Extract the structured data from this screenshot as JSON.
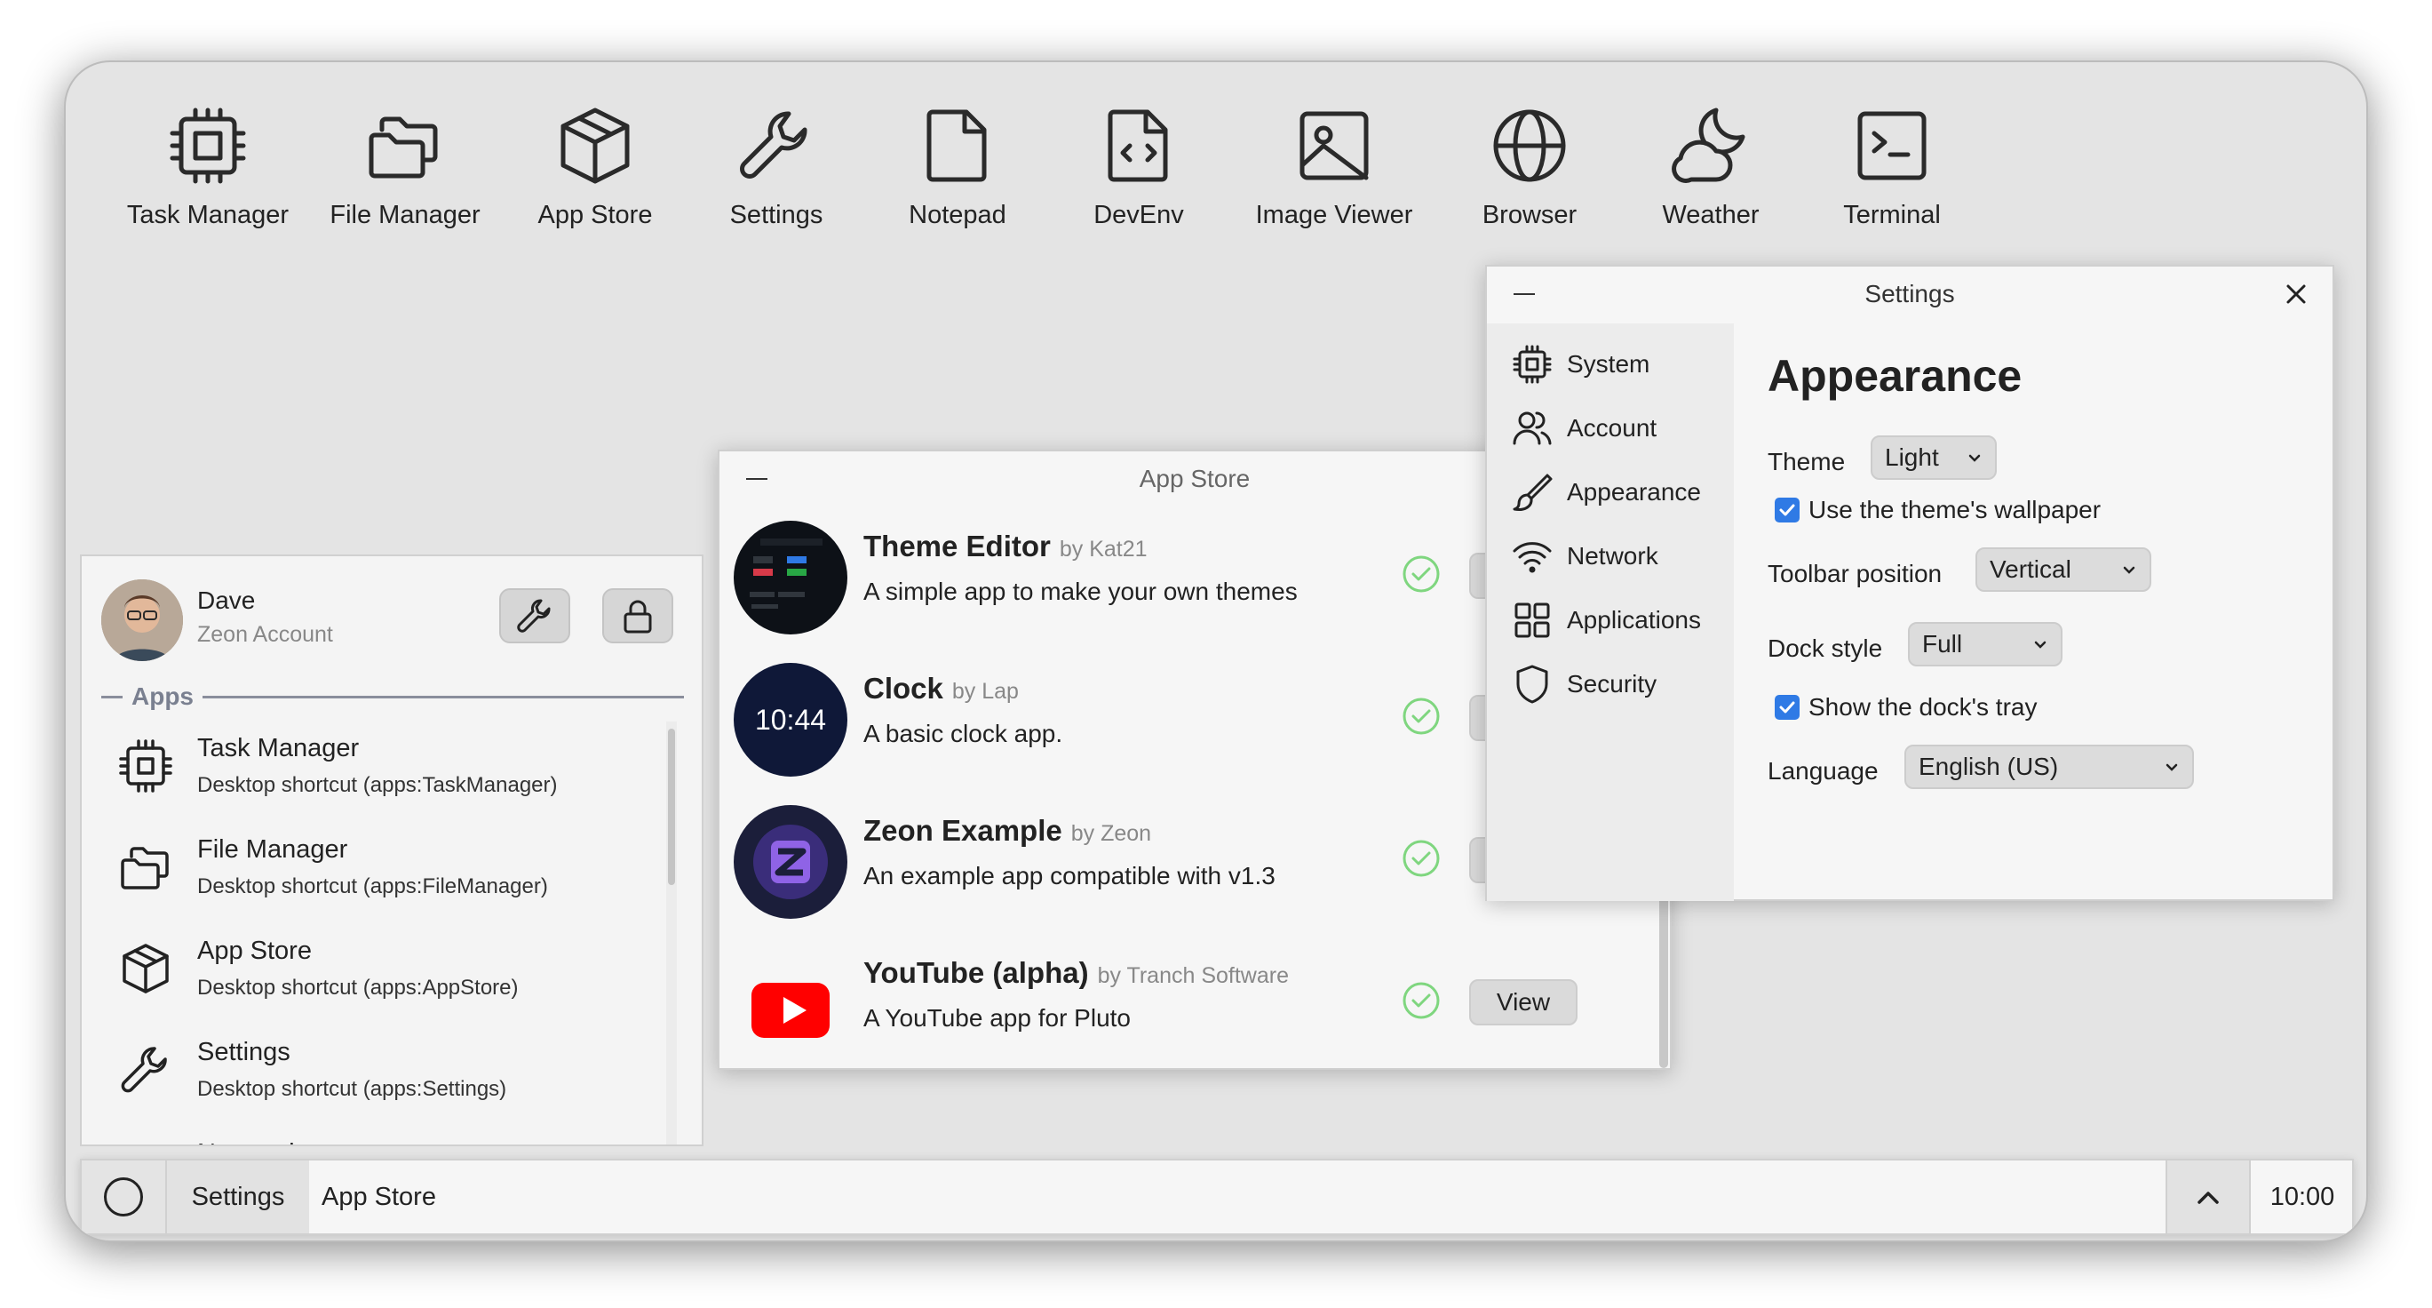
{
  "desktop": {
    "icons": [
      {
        "label": "Task Manager",
        "icon": "cpu-icon"
      },
      {
        "label": "File Manager",
        "icon": "folder-icon"
      },
      {
        "label": "App Store",
        "icon": "package-icon"
      },
      {
        "label": "Settings",
        "icon": "wrench-icon"
      },
      {
        "label": "Notepad",
        "icon": "file-icon"
      },
      {
        "label": "DevEnv",
        "icon": "code-file-icon"
      },
      {
        "label": "Image Viewer",
        "icon": "image-icon"
      },
      {
        "label": "Browser",
        "icon": "globe-icon"
      },
      {
        "label": "Weather",
        "icon": "cloud-moon-icon"
      },
      {
        "label": "Terminal",
        "icon": "terminal-icon"
      }
    ]
  },
  "launcher": {
    "user_name": "Dave",
    "user_account": "Zeon Account",
    "apps_header": "Apps",
    "apps": [
      {
        "name": "Task Manager",
        "desc": "Desktop shortcut (apps:TaskManager)",
        "icon": "cpu-icon"
      },
      {
        "name": "File Manager",
        "desc": "Desktop shortcut (apps:FileManager)",
        "icon": "folder-icon"
      },
      {
        "name": "App Store",
        "desc": "Desktop shortcut (apps:AppStore)",
        "icon": "package-icon"
      },
      {
        "name": "Settings",
        "desc": "Desktop shortcut (apps:Settings)",
        "icon": "wrench-icon"
      },
      {
        "name": "Notepad",
        "desc": "",
        "icon": "file-icon"
      }
    ]
  },
  "app_store": {
    "title": "App Store",
    "view_label": "View",
    "items": [
      {
        "name": "Theme Editor",
        "author": "by Kat21",
        "desc": "A simple app to make your own themes"
      },
      {
        "name": "Clock",
        "author": "by Lap",
        "desc": "A basic clock app.",
        "logo_text": "10:44"
      },
      {
        "name": "Zeon Example",
        "author": "by Zeon",
        "desc": "An example app compatible with v1.3"
      },
      {
        "name": "YouTube (alpha)",
        "author": "by Tranch Software",
        "desc": "A YouTube app for Pluto"
      }
    ]
  },
  "settings": {
    "title": "Settings",
    "nav": [
      {
        "label": "System",
        "icon": "cpu-icon"
      },
      {
        "label": "Account",
        "icon": "users-icon"
      },
      {
        "label": "Appearance",
        "icon": "brush-icon"
      },
      {
        "label": "Network",
        "icon": "wifi-icon"
      },
      {
        "label": "Applications",
        "icon": "grid-icon"
      },
      {
        "label": "Security",
        "icon": "shield-icon"
      }
    ],
    "heading": "Appearance",
    "theme_label": "Theme",
    "theme_value": "Light",
    "wallpaper_label": "Use the theme's wallpaper",
    "toolbar_label": "Toolbar position",
    "toolbar_value": "Vertical",
    "dock_label": "Dock style",
    "dock_value": "Full",
    "tray_label": "Show the dock's tray",
    "language_label": "Language",
    "language_value": "English (US)"
  },
  "taskbar": {
    "tasks": [
      "Settings",
      "App Store"
    ],
    "clock": "10:00"
  },
  "colors": {
    "accent": "#2f7ae5",
    "check_green": "#7fd67f"
  }
}
